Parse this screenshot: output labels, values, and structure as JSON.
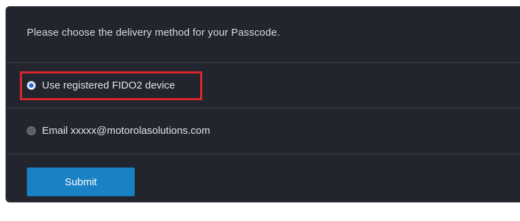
{
  "prompt": {
    "text": "Please choose the delivery method for your Passcode."
  },
  "options": [
    {
      "label": "Use registered FIDO2 device",
      "selected": true
    },
    {
      "label": "Email xxxxx@motorolasolutions.com",
      "selected": false
    }
  ],
  "submit": {
    "label": "Submit"
  },
  "colors": {
    "panel_background": "#22252d",
    "highlight_border": "#e3262e",
    "submit_background": "#1a82c4",
    "radio_selected": "#2f6fd8"
  }
}
